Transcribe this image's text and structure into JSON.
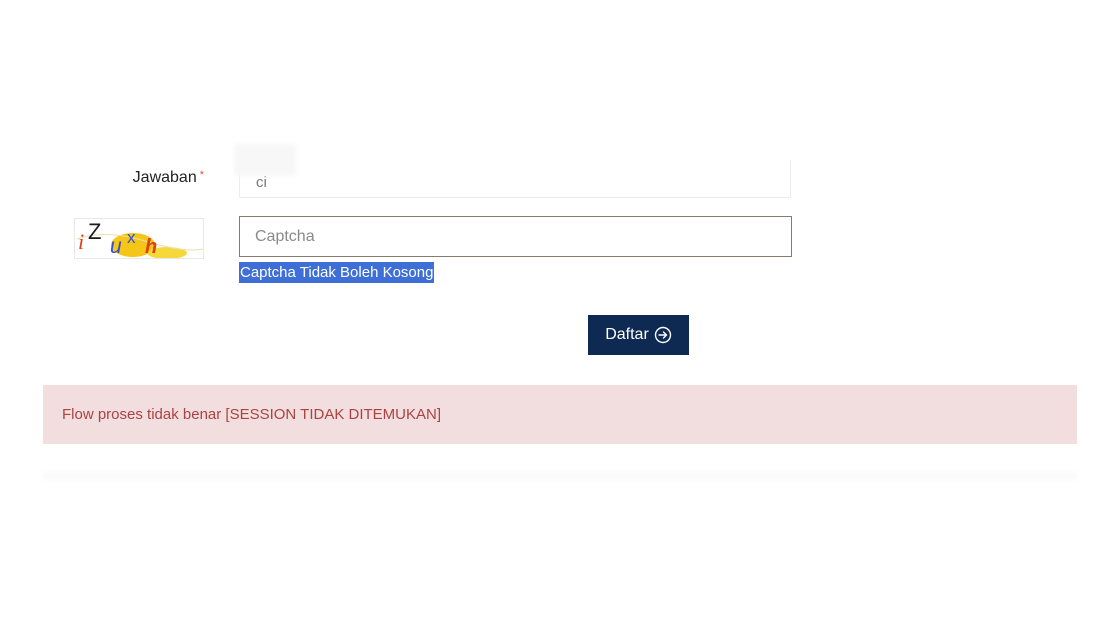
{
  "form": {
    "answer_label": "Jawaban",
    "required_mark": "*",
    "answer_value": "ci",
    "captcha_placeholder": "Captcha",
    "captcha_image_text": "iZuxh",
    "captcha_error": "Captcha Tidak Boleh Kosong",
    "submit_label": "Daftar",
    "submit_icon": "circle-arrow-right-icon"
  },
  "alert": {
    "message": "Flow proses tidak benar [SESSION TIDAK DITEMUKAN]"
  },
  "colors": {
    "button_bg": "#0f2a52",
    "alert_bg": "#f2dede",
    "alert_text": "#a94442",
    "error_highlight": "#3d6fd6",
    "required_mark": "#d9534f"
  }
}
